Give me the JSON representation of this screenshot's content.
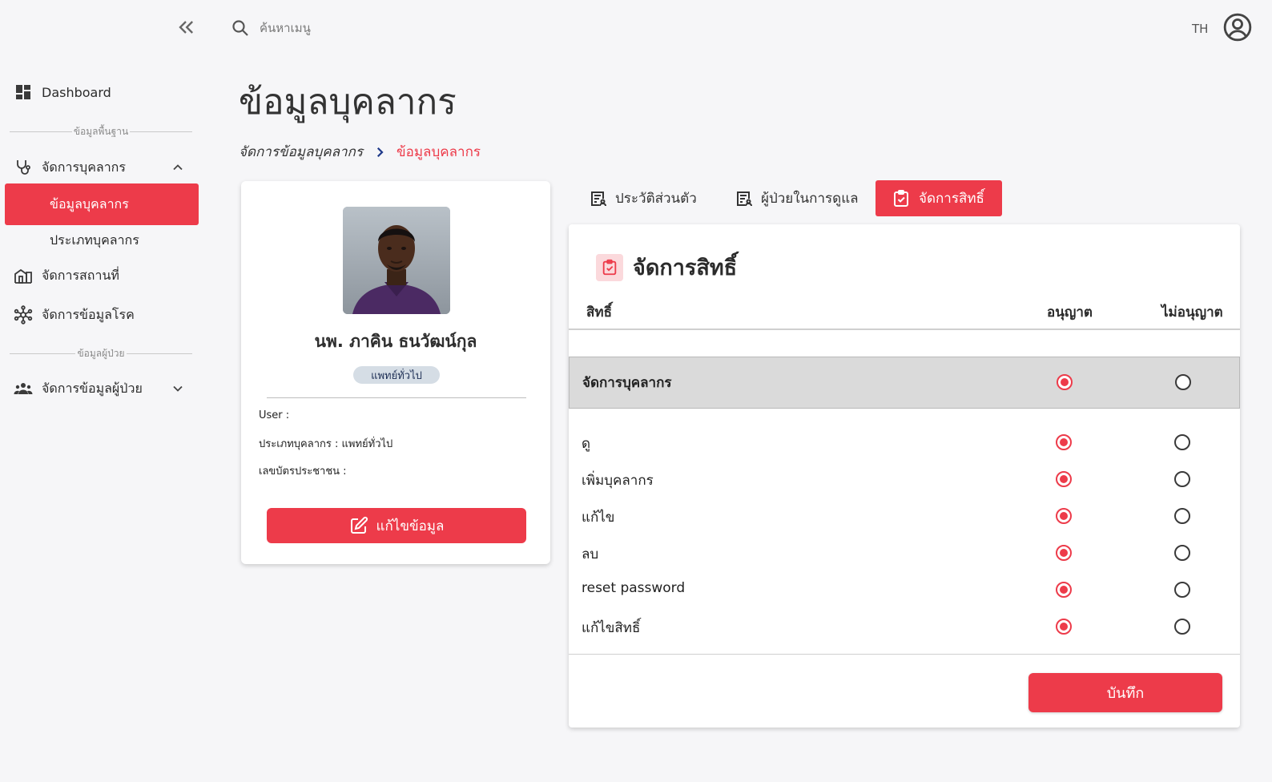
{
  "sidebar": {
    "collapse_icon": "double-chevron-left-icon",
    "dashboard_label": "Dashboard",
    "section_basic": "ข้อมูลพื้นฐาน",
    "staff_mgmt_label": "จัดการบุคลากร",
    "staff_sub": [
      "ข้อมูลบุคลากร",
      "ประเภทบุคลากร"
    ],
    "location_label": "จัดการสถานที่",
    "disease_label": "จัดการข้อมูลโรค",
    "section_patient": "ข้อมูลผู้ป่วย",
    "patient_label": "จัดการข้อมูลผู้ป่วย"
  },
  "topbar": {
    "search_placeholder": "ค้นหาเมนู",
    "lang": "TH"
  },
  "page": {
    "title": "ข้อมูลบุคลากร",
    "breadcrumb": [
      "จัดการข้อมูลบุคลากร",
      "ข้อมูลบุคลากร"
    ]
  },
  "profile": {
    "name": "นพ. ภาคิน ธนวัฒน์กุล",
    "role": "แพทย์ทั่วไป",
    "user_line": "User :",
    "type_line": "ประเภทบุคลากร : แพทย์ทั่วไป",
    "id_line": "เลขบัตรประชาชน :",
    "edit_label": "แก้ไขข้อมูล"
  },
  "tabs": [
    {
      "label": "ประวัติส่วนตัว",
      "icon": "document-person-icon"
    },
    {
      "label": "ผู้ป่วยในการดูแล",
      "icon": "document-person-icon"
    },
    {
      "label": "จัดการสิทธิ์",
      "icon": "clipboard-check-icon"
    }
  ],
  "permissions": {
    "title": "จัดการสิทธิ์",
    "col_permission": "สิทธิ์",
    "col_allow": "อนุญาต",
    "col_deny": "ไม่อนุญาต",
    "group": {
      "label": "จัดการบุคลากร",
      "allowed": true
    },
    "rows": [
      {
        "label": "ดู",
        "allowed": true
      },
      {
        "label": "เพิ่มบุคลากร",
        "allowed": true
      },
      {
        "label": "แก้ไข",
        "allowed": true
      },
      {
        "label": "ลบ",
        "allowed": true
      },
      {
        "label": "reset password",
        "allowed": true
      },
      {
        "label": "แก้ไขสิทธิ์",
        "allowed": true
      }
    ],
    "save_label": "บันทึก"
  },
  "colors": {
    "accent": "#ed3b4a",
    "background": "#f6f6f8"
  }
}
